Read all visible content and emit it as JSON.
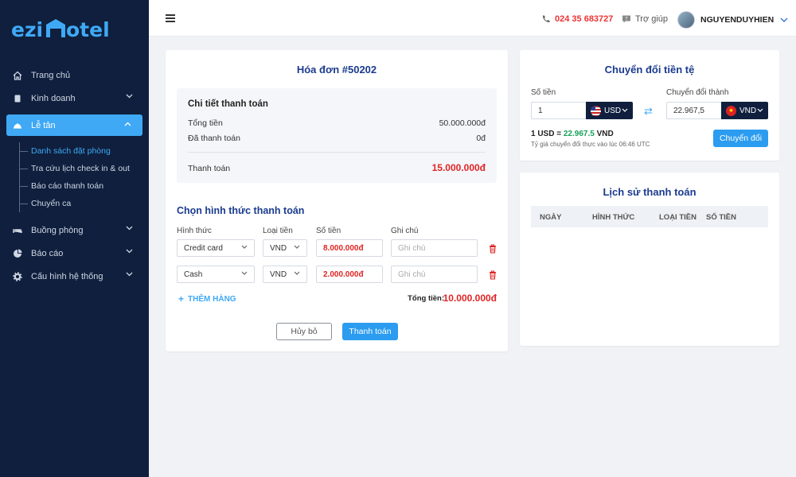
{
  "brand": {
    "logo_text": "ezihotel",
    "accent": "#3fa9f5"
  },
  "sidebar": {
    "items": [
      {
        "label": "Trang chủ",
        "icon": "home-icon"
      },
      {
        "label": "Kinh doanh",
        "icon": "book-icon"
      },
      {
        "label": "Lễ tân",
        "icon": "reception-bell-icon"
      },
      {
        "label": "Buồng phòng",
        "icon": "bed-icon"
      },
      {
        "label": "Báo cáo",
        "icon": "pie-chart-icon"
      },
      {
        "label": "Cấu hình hệ thống",
        "icon": "gear-icon"
      }
    ],
    "subitems": [
      {
        "label": "Danh sách đặt phòng"
      },
      {
        "label": "Tra cứu lịch check in & out"
      },
      {
        "label": "Báo cáo thanh toán"
      },
      {
        "label": "Chuyển ca"
      }
    ]
  },
  "topbar": {
    "phone": "024 35 683727",
    "help": "Trợ giúp",
    "username": "NGUYENDUYHIEN"
  },
  "invoice": {
    "title": "Hóa đơn #50202",
    "details": {
      "header": "Chi tiết thanh toán",
      "total_label": "Tổng tiền",
      "total_value": "50.000.000đ",
      "paid_label": "Đã thanh toán",
      "paid_value": "0đ",
      "pay_label": "Thanh toán",
      "pay_value": "15.000.000đ"
    },
    "method_title": "Chọn hình thức thanh toán",
    "columns": {
      "method": "Hình thức",
      "currency": "Loại tiền",
      "amount": "Số tiền",
      "note": "Ghi chú"
    },
    "rows": [
      {
        "method": "Credit card",
        "currency": "VND",
        "amount": "8.000.000đ",
        "note_placeholder": "Ghi chú"
      },
      {
        "method": "Cash",
        "currency": "VND",
        "amount": "2.000.000đ",
        "note_placeholder": "Ghi chú"
      }
    ],
    "add_row": "THÊM HÀNG",
    "sum_label": "Tổng tiền:",
    "sum_value": "10.000.000đ",
    "cancel": "Hủy bỏ",
    "pay": "Thanh toán"
  },
  "converter": {
    "title": "Chuyển đổi tiền tệ",
    "amount_label": "Số tiền",
    "convert_to_label": "Chuyển đổi thành",
    "amount_value": "1",
    "from_currency": "USD",
    "result_value": "22.967,5",
    "to_currency": "VND",
    "rate_prefix": "1 USD = ",
    "rate_value": "22.967.5",
    "rate_suffix": " VND",
    "rate_note": "Tỷ giá chuyển đổi thực vào lúc 06:46 UTC",
    "button": "Chuyển đổi"
  },
  "history": {
    "title": "Lịch sử thanh toán",
    "columns": [
      "NGÀY",
      "HÌNH THỨC",
      "LOẠI TIỀN",
      "SỐ TIỀN"
    ]
  }
}
